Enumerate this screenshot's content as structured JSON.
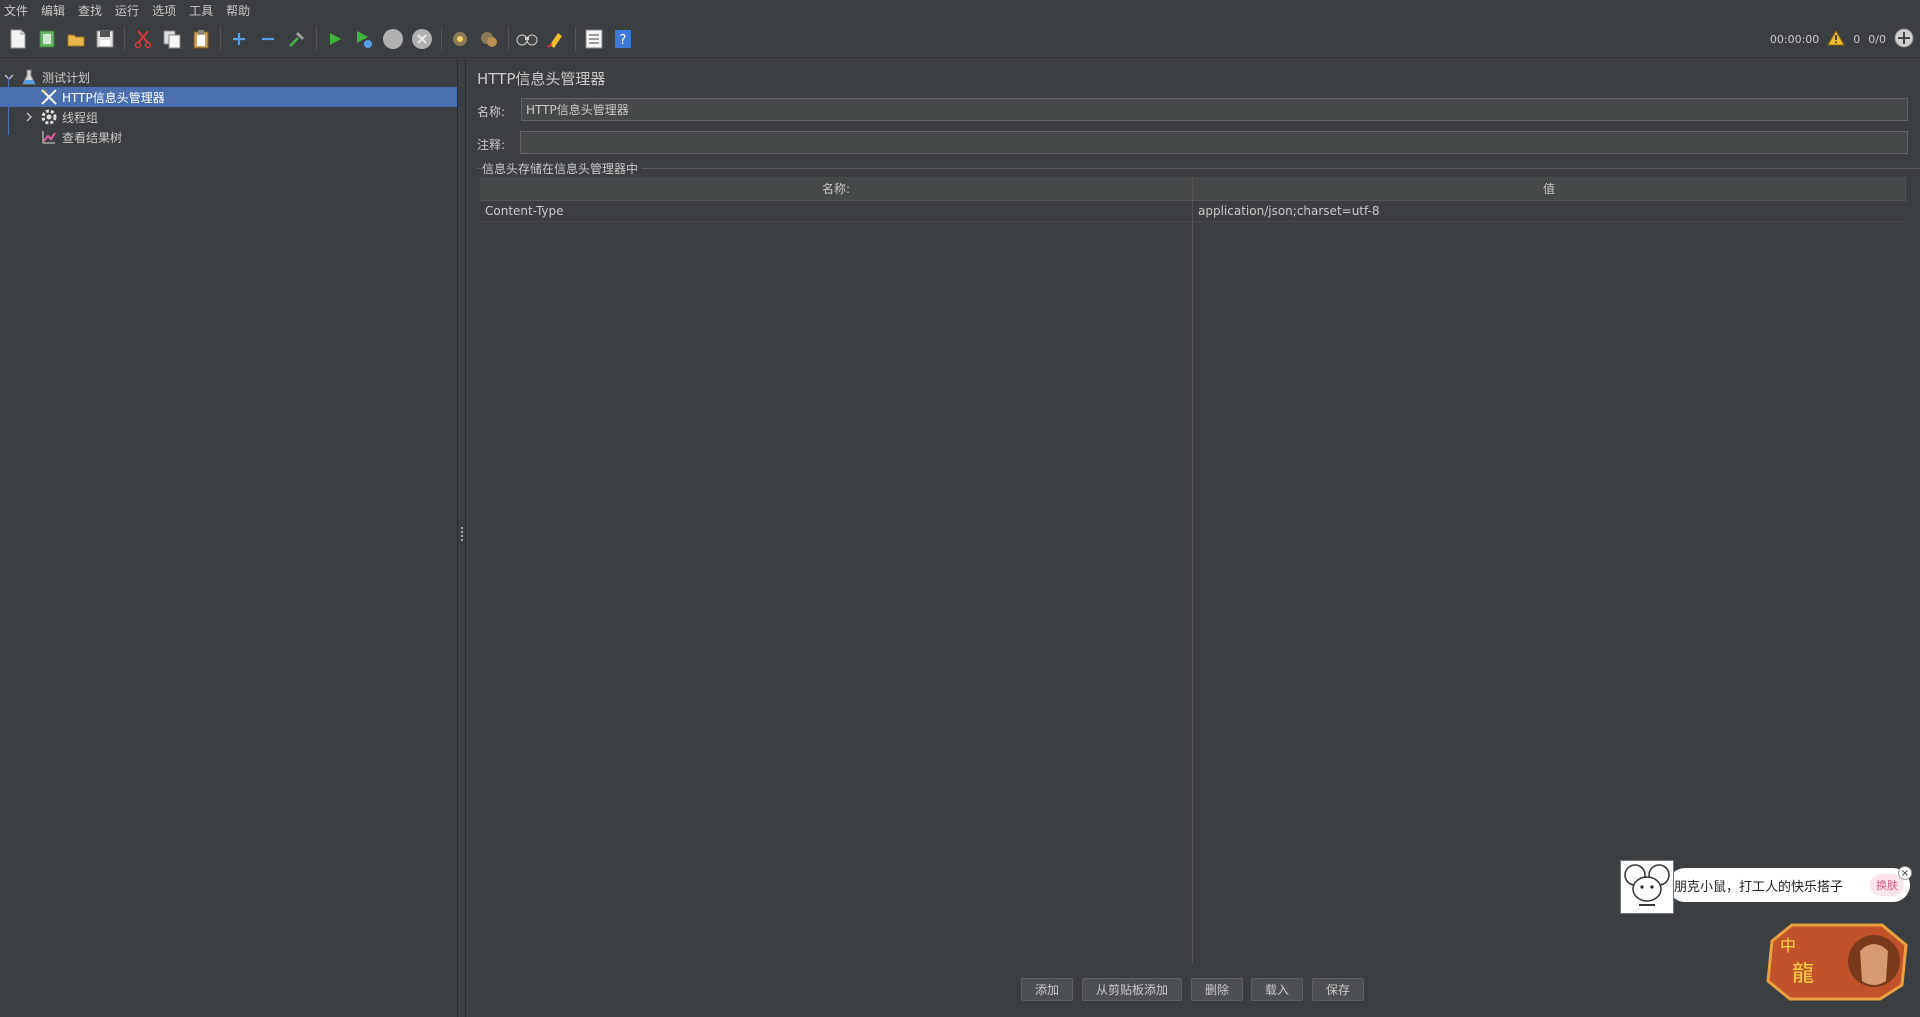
{
  "menu": [
    "文件",
    "编辑",
    "查找",
    "运行",
    "选项",
    "工具",
    "帮助"
  ],
  "toolbar": {
    "buttons": [
      "new-icon",
      "templates-icon",
      "open-icon",
      "save-icon",
      "cut-icon",
      "copy-icon",
      "paste-icon",
      "expand-icon",
      "collapse-icon",
      "toggle-icon",
      "start-icon",
      "start-no-pause-icon",
      "stop-icon",
      "shutdown-icon",
      "clear-icon",
      "clear-all-icon",
      "search-icon",
      "reset-search-icon",
      "function-helper-icon",
      "help-icon"
    ],
    "timer": "00:00:00",
    "warning_count": "0",
    "threads": "0/0"
  },
  "tree": {
    "items": [
      {
        "label": "测试计划",
        "icon": "test-plan-icon"
      },
      {
        "label": "HTTP信息头管理器",
        "icon": "header-manager-icon",
        "selected": true
      },
      {
        "label": "线程组",
        "icon": "thread-group-icon"
      },
      {
        "label": "查看结果树",
        "icon": "results-tree-icon"
      }
    ]
  },
  "panel": {
    "title": "HTTP信息头管理器",
    "name_label": "名称:",
    "name_value": "HTTP信息头管理器",
    "comment_label": "注释:",
    "comment_value": "",
    "group_title": "信息头存储在信息头管理器中",
    "table": {
      "headers": [
        "名称:",
        "值"
      ],
      "rows": [
        [
          "Content-Type",
          "application/json;charset=utf-8"
        ]
      ]
    },
    "buttons": {
      "add": "添加",
      "add_clipboard": "从剪贴板添加",
      "delete": "删除",
      "load": "载入",
      "save": "保存"
    }
  },
  "popup": {
    "message": "朋克小鼠，打工人的快乐搭子",
    "change_label": "换肤",
    "close_label": "×"
  },
  "colors": {
    "background": "#3c3f41",
    "selection": "#4b6eaf",
    "text": "#c8c8c8"
  }
}
